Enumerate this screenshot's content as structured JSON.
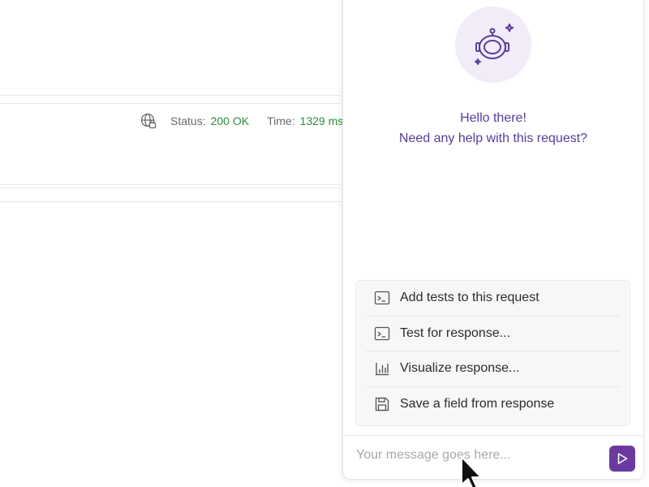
{
  "status_bar": {
    "status_label": "Status:",
    "status_value": "200 OK",
    "time_label": "Time:",
    "time_value": "1329 ms",
    "globe_icon": "globe-lock-icon"
  },
  "assistant": {
    "avatar_icon": "astronaut-helmet-icon",
    "greeting_line1": "Hello there!",
    "greeting_line2": "Need any help with this request?",
    "suggestions": [
      {
        "label": "Add tests to this request",
        "icon": "terminal-icon"
      },
      {
        "label": "Test for response...",
        "icon": "terminal-icon"
      },
      {
        "label": "Visualize response...",
        "icon": "bar-chart-icon"
      },
      {
        "label": "Save a field from response",
        "icon": "save-icon"
      }
    ],
    "input_placeholder": "Your message goes here...",
    "send_icon": "send-icon"
  },
  "colors": {
    "accent": "#6b3aa0",
    "greeting_text": "#5b3b9a",
    "status_ok": "#2f8c3c",
    "avatar_bg": "#f2ecf8"
  }
}
